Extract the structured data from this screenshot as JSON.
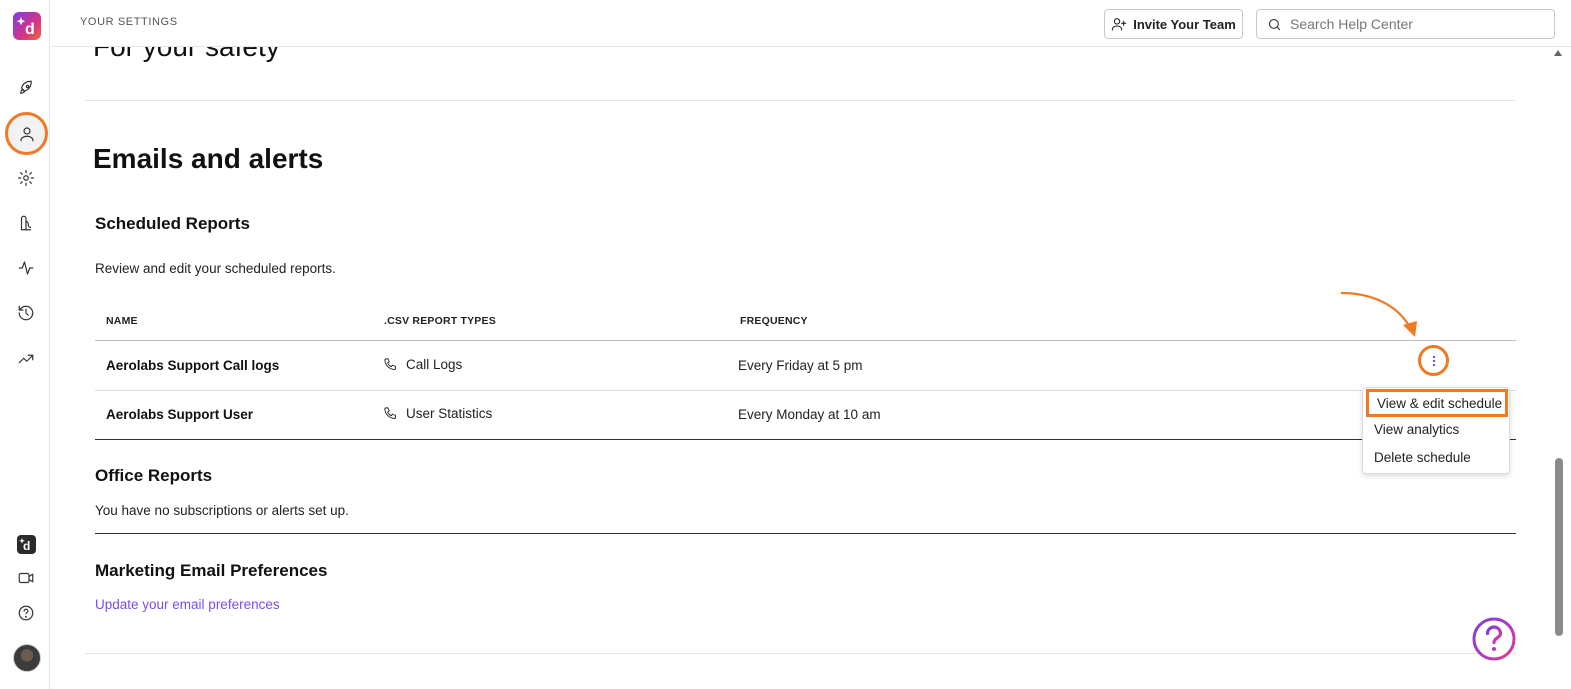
{
  "app": {
    "logo_icon": "dialpad-logo-icon",
    "brand_color": "#7b3fe4",
    "highlight_color": "#f07a24",
    "link_color": "#7b4dea"
  },
  "rail": {
    "items": [
      {
        "icon": "rocket-icon"
      },
      {
        "icon": "user-icon",
        "active": true
      },
      {
        "icon": "gear-icon"
      },
      {
        "icon": "contact-center-icon"
      },
      {
        "icon": "activity-pulse-icon"
      },
      {
        "icon": "history-icon"
      },
      {
        "icon": "trending-up-icon"
      }
    ],
    "bottom": [
      {
        "icon": "app-logo-small-icon"
      },
      {
        "icon": "video-icon"
      },
      {
        "icon": "help-circle-icon"
      },
      {
        "icon": "avatar"
      }
    ]
  },
  "header": {
    "breadcrumb": "YOUR SETTINGS",
    "invite_label": "Invite Your Team",
    "search_placeholder": "Search Help Center"
  },
  "main": {
    "cut_title": "For your safety",
    "section_title": "Emails and alerts",
    "scheduled": {
      "title": "Scheduled Reports",
      "description": "Review and edit your scheduled reports.",
      "columns": [
        "NAME",
        ".CSV REPORT TYPES",
        "FREQUENCY"
      ],
      "rows": [
        {
          "name": "Aerolabs Support Call logs",
          "type": "Call Logs",
          "frequency": "Every Friday at 5 pm"
        },
        {
          "name": "Aerolabs Support User",
          "type": "User Statistics",
          "frequency": "Every Monday at 10 am"
        }
      ]
    },
    "menu": {
      "items": [
        "View & edit schedule",
        "View analytics",
        "Delete schedule"
      ]
    },
    "office": {
      "title": "Office Reports",
      "description": "You have no subscriptions or alerts set up."
    },
    "marketing": {
      "title": "Marketing Email Preferences",
      "link": "Update your email preferences"
    }
  }
}
